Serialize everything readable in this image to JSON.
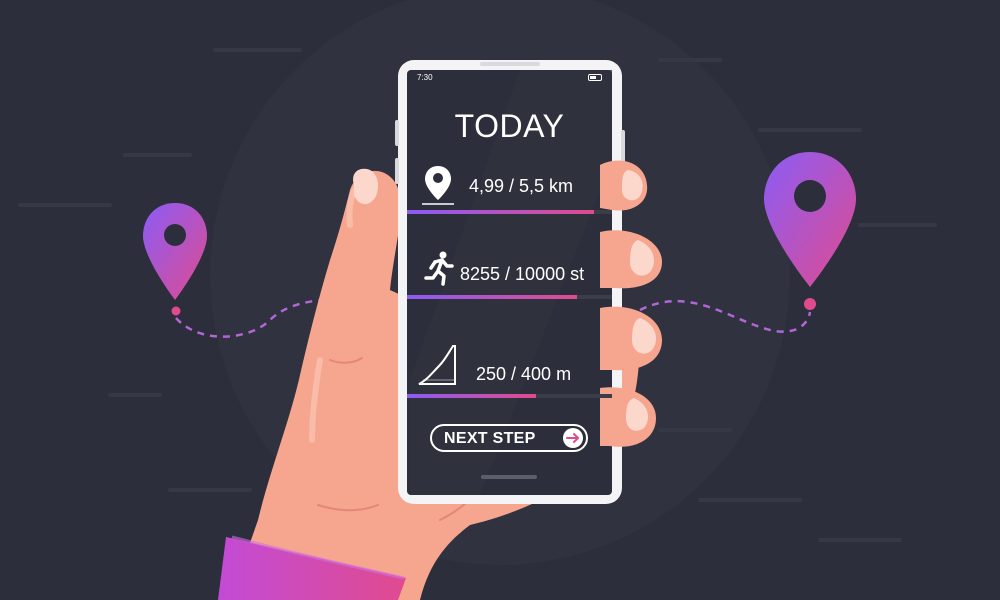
{
  "status_bar": {
    "time": "7:30"
  },
  "screen": {
    "title": "TODAY",
    "metrics": [
      {
        "icon": "location-pin-icon",
        "value": "4,99 / 5,5 km",
        "progress": 0.91
      },
      {
        "icon": "runner-icon",
        "value": "8255 / 10000 st",
        "progress": 0.83
      },
      {
        "icon": "incline-icon",
        "value": "250 / 400 m",
        "progress": 0.63
      }
    ],
    "next_button": {
      "label": "NEXT STEP",
      "icon": "arrow-right-icon"
    }
  },
  "colors": {
    "background": "#2c2e3b",
    "accent_purple": "#8b5cf6",
    "accent_pink": "#e04b8e",
    "skin": "#f6a58f",
    "phone_frame": "#f4f4f6"
  }
}
